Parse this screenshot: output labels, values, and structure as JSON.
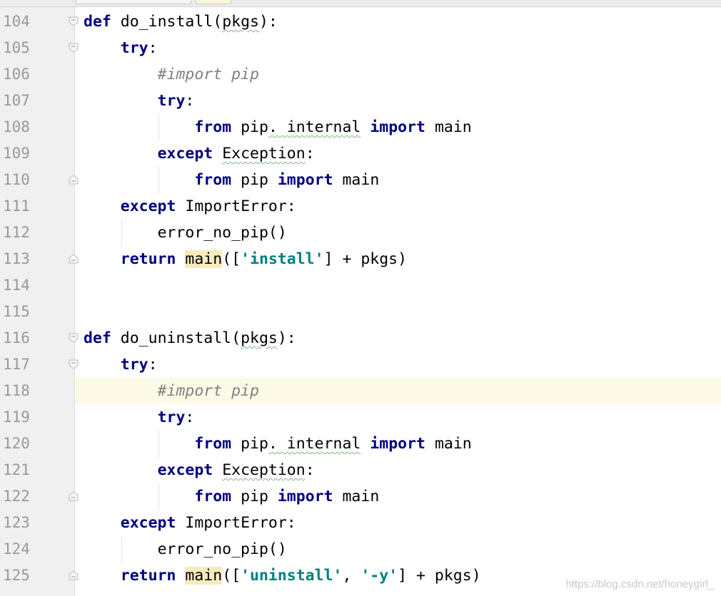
{
  "line_numbers": [
    "104",
    "105",
    "106",
    "107",
    "108",
    "109",
    "110",
    "111",
    "112",
    "113",
    "114",
    "115",
    "116",
    "117",
    "118",
    "119",
    "120",
    "121",
    "122",
    "123",
    "124",
    "125"
  ],
  "tokens": {
    "def": "def",
    "do_install": " do_install(",
    "do_uninstall": " do_uninstall(",
    "pkgs": "pkgs",
    "paren_colon": "):",
    "try": "try",
    "colon": ":",
    "comment": "#import pip",
    "from": "from",
    "pip": " pip",
    "internal": ". internal",
    "import": "import",
    "main": "main",
    "except": "except",
    "exception": "Exception",
    "importerror": "ImportError",
    "error_no_pip": "error_no_pip()",
    "return": "return",
    "open_bracket": "([",
    "str_install": "'install'",
    "str_uninstall": "'uninstall'",
    "comma": ", ",
    "str_y": "'-y'",
    "close_plus": "] + pkgs)"
  },
  "watermark": "https://blog.csdn.net/honeygirl_",
  "colors": {
    "keyword": "#000080",
    "string": "#008080",
    "comment": "#808080",
    "current_line": "#fcf9e6",
    "highlight": "#f6ebbc"
  }
}
